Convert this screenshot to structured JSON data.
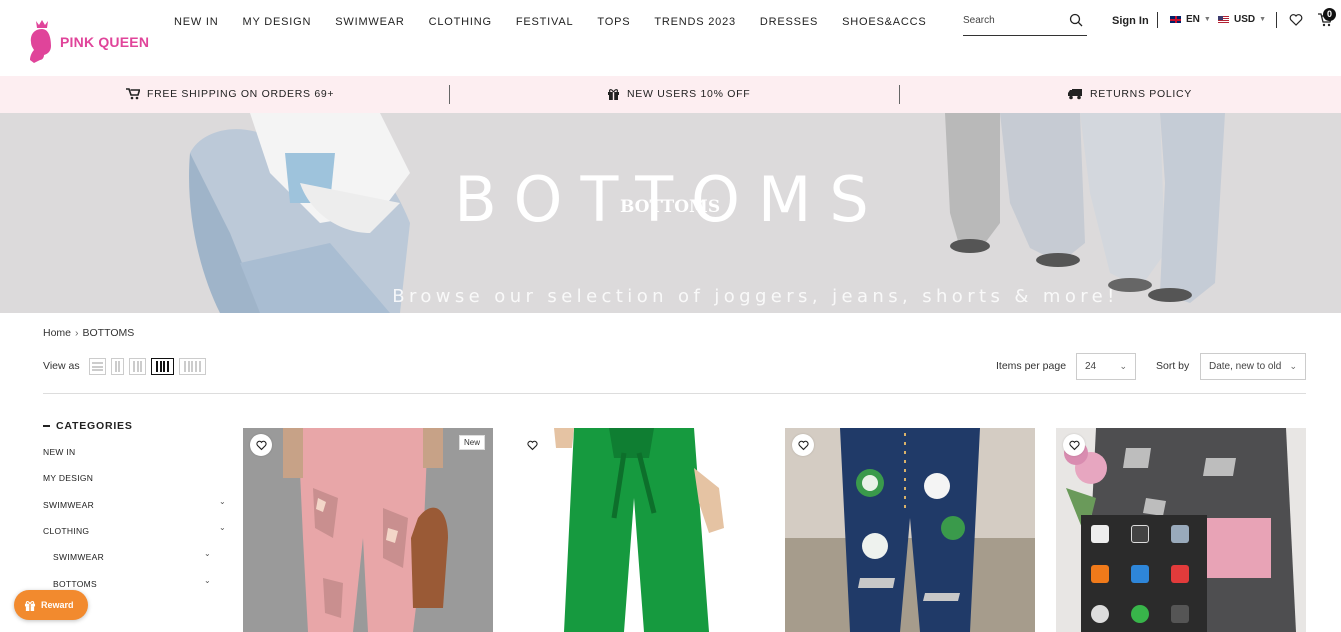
{
  "brand": {
    "name": "PINK QUEEN",
    "color": "#e0449a"
  },
  "nav": [
    "NEW IN",
    "MY DESIGN",
    "SWIMWEAR",
    "CLOTHING",
    "FESTIVAL",
    "TOPS",
    "TRENDS 2023",
    "DRESSES",
    "SHOES&ACCS"
  ],
  "header": {
    "search_placeholder": "Search",
    "signin": "Sign In",
    "language": "EN",
    "currency": "USD",
    "cart_count": "0"
  },
  "promo": {
    "shipping": "FREE SHIPPING ON ORDERS 69+",
    "new_users": "NEW USERS 10% OFF",
    "returns": "RETURNS POLICY",
    "background": "#fdeef1"
  },
  "banner": {
    "title": "BOTTOMS",
    "title_overlay": "BOTTOMS",
    "subtitle": "Browse our selection of joggers, jeans, shorts & more!"
  },
  "breadcrumb": {
    "home": "Home",
    "current": "BOTTOMS"
  },
  "toolbar": {
    "view_as": "View as",
    "items_per_page_label": "Items per page",
    "items_per_page_value": "24",
    "sort_by_label": "Sort by",
    "sort_by_value": "Date, new to old"
  },
  "sidebar": {
    "heading": "CATEGORIES",
    "items": [
      {
        "label": "NEW IN",
        "expandable": false
      },
      {
        "label": "MY DESIGN",
        "expandable": false
      },
      {
        "label": "SWIMWEAR",
        "expandable": true
      },
      {
        "label": "CLOTHING",
        "expandable": true
      },
      {
        "label": "SWIMWEAR",
        "expandable": true,
        "sub": true
      },
      {
        "label": "BOTTOMS",
        "expandable": true,
        "sub": true
      }
    ]
  },
  "products": [
    {
      "badge": "New",
      "image": "pink-distressed-jeans"
    },
    {
      "badge": "",
      "image": "green-wide-leg-pants"
    },
    {
      "badge": "",
      "image": "shamrock-patch-jeans"
    },
    {
      "badge": "",
      "image": "grey-patchwork-jeans"
    }
  ],
  "reward_label": "Reward",
  "accent": "#f28a2e"
}
